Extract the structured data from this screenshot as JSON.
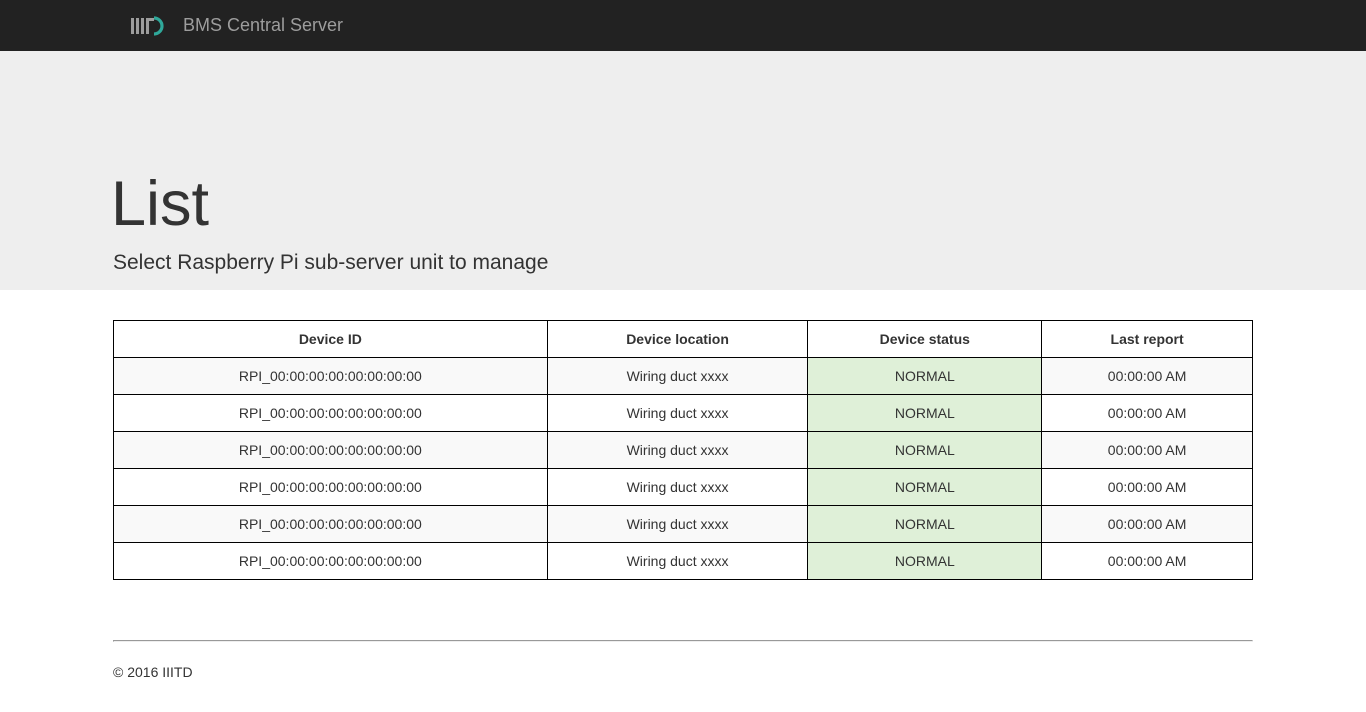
{
  "navbar": {
    "brand_title": "BMS Central Server",
    "logo_icon": "iiitd-logo-icon",
    "logo_text": "IIITD",
    "logo_accent_color": "#2fa89a"
  },
  "jumbotron": {
    "title": "List",
    "subtitle": "Select Raspberry Pi sub-server unit to manage"
  },
  "table": {
    "headers": [
      "Device ID",
      "Device location",
      "Device status",
      "Last report"
    ],
    "rows": [
      [
        "RPI_00:00:00:00:00:00:00:00",
        "Wiring duct xxxx",
        "NORMAL",
        "00:00:00 AM"
      ],
      [
        "RPI_00:00:00:00:00:00:00:00",
        "Wiring duct xxxx",
        "NORMAL",
        "00:00:00 AM"
      ],
      [
        "RPI_00:00:00:00:00:00:00:00",
        "Wiring duct xxxx",
        "NORMAL",
        "00:00:00 AM"
      ],
      [
        "RPI_00:00:00:00:00:00:00:00",
        "Wiring duct xxxx",
        "NORMAL",
        "00:00:00 AM"
      ],
      [
        "RPI_00:00:00:00:00:00:00:00",
        "Wiring duct xxxx",
        "NORMAL",
        "00:00:00 AM"
      ],
      [
        "RPI_00:00:00:00:00:00:00:00",
        "Wiring duct xxxx",
        "NORMAL",
        "00:00:00 AM"
      ]
    ],
    "status_color": "#dff0d8"
  },
  "footer": {
    "copyright": "© 2016 IIITD"
  }
}
